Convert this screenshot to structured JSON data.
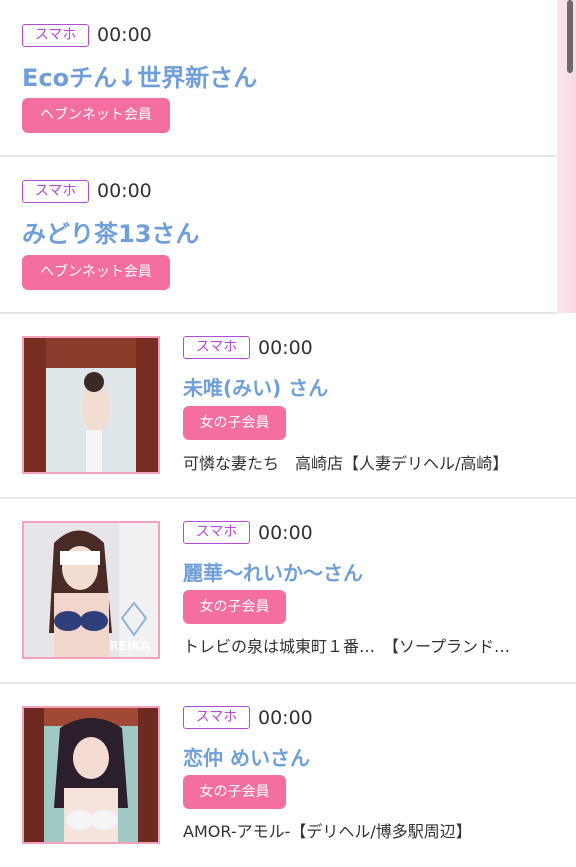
{
  "colors": {
    "accent_blue": "#6f9fd8",
    "tag_purple": "#b44bd6",
    "pill_pink": "#f46ea0",
    "divider": "#e6e6e6"
  },
  "posts": [
    {
      "tag": "スマホ",
      "time": "00:00",
      "name": "Ecoチん↓世界新さん",
      "badge": "ヘブンネット会員",
      "shop": "",
      "has_photo": false
    },
    {
      "tag": "スマホ",
      "time": "00:00",
      "name": "みどり茶13さん",
      "badge": "ヘブンネット会員",
      "shop": "",
      "has_photo": false
    },
    {
      "tag": "スマホ",
      "time": "00:00",
      "name": "未唯(みい) さん",
      "badge": "女の子会員",
      "shop": "可憐な妻たち　高崎店【人妻デリヘル/高崎】",
      "has_photo": true
    },
    {
      "tag": "スマホ",
      "time": "00:00",
      "name": "麗華〜れいか〜さん",
      "badge": "女の子会員",
      "shop": "トレビの泉は城東町１番…　【ソープランド…",
      "has_photo": true,
      "photo_text": "REIKA"
    },
    {
      "tag": "スマホ",
      "time": "00:00",
      "name": "恋仲 めいさん",
      "badge": "女の子会員",
      "shop": "AMOR-アモル-【デリヘル/博多駅周辺】",
      "has_photo": true
    }
  ]
}
